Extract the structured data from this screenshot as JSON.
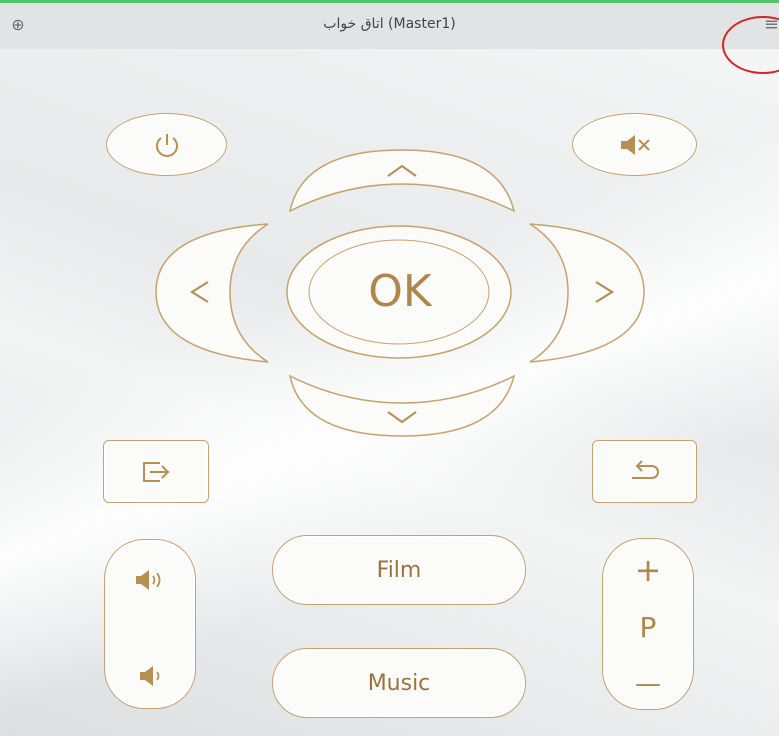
{
  "header": {
    "title": "اتاق خواب (Master1)",
    "add_icon": "⊕",
    "menu_icon": "≡"
  },
  "remote": {
    "ok_label": "OK",
    "film_label": "Film",
    "music_label": "Music",
    "channel_plus": "+",
    "channel_label": "P",
    "channel_minus": "—"
  },
  "icons": {
    "power": "power-icon",
    "mute": "mute-icon",
    "up": "chevron-up-icon",
    "down": "chevron-down-icon",
    "left": "chevron-left-icon",
    "right": "chevron-right-icon",
    "exit": "exit-icon",
    "back": "back-icon",
    "volume_up": "volume-up-icon",
    "volume_down": "volume-down-icon"
  },
  "colors": {
    "accent": "#c6a26d",
    "icon": "#b88f52",
    "topbar_line": "#4fc46a",
    "annotation": "#d62424"
  }
}
